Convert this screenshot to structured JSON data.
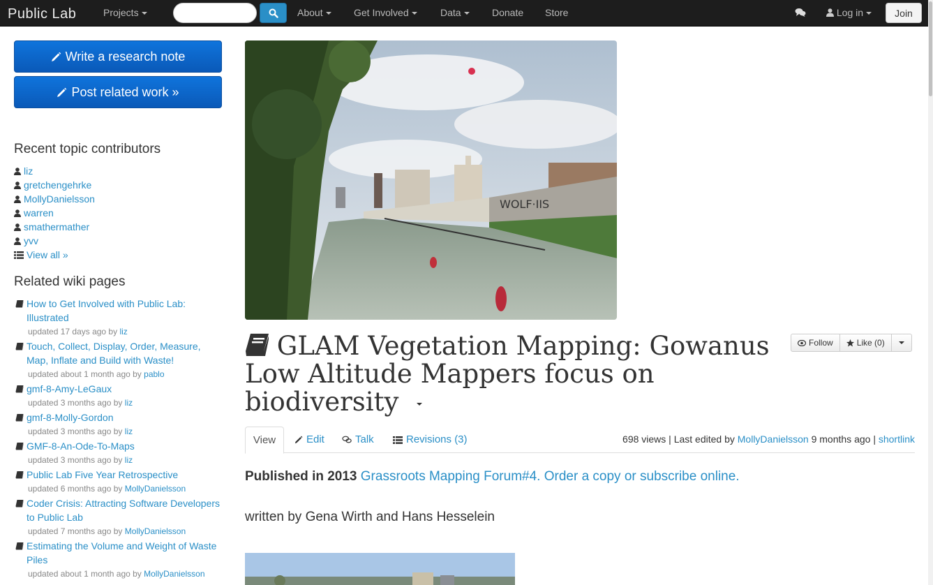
{
  "nav": {
    "brand": "Public Lab",
    "projects": "Projects",
    "search_placeholder": "",
    "about": "About",
    "get_involved": "Get Involved",
    "data": "Data",
    "donate": "Donate",
    "store": "Store",
    "login": "Log in",
    "join": "Join"
  },
  "sidebar": {
    "write_note": "Write a research note",
    "post_related": "Post related work »",
    "contributors_heading": "Recent topic contributors",
    "contributors": [
      "liz",
      "gretchengehrke",
      "MollyDanielsson",
      "warren",
      "smathermather",
      "yvv"
    ],
    "view_all": "View all »",
    "wiki_heading": "Related wiki pages",
    "wiki_pages": [
      {
        "title": "How to Get Involved with Public Lab: Illustrated",
        "updated": "updated 17 days ago by",
        "author": "liz"
      },
      {
        "title": "Touch, Collect, Display, Order, Measure, Map, Inflate and Build with Waste!",
        "updated": "updated about 1 month ago by",
        "author": "pablo"
      },
      {
        "title": "gmf-8-Amy-LeGaux",
        "updated": "updated 3 months ago by",
        "author": "liz"
      },
      {
        "title": "gmf-8-Molly-Gordon",
        "updated": "updated 3 months ago by",
        "author": "liz"
      },
      {
        "title": "GMF-8-An-Ode-To-Maps",
        "updated": "updated 3 months ago by",
        "author": "liz"
      },
      {
        "title": "Public Lab Five Year Retrospective",
        "updated": "updated 6 months ago by",
        "author": "MollyDanielsson"
      },
      {
        "title": "Coder Crisis: Attracting Software Developers to Public Lab",
        "updated": "updated 7 months ago by",
        "author": "MollyDanielsson"
      },
      {
        "title": "Estimating the Volume and Weight of Waste Piles",
        "updated": "updated about 1 month ago by",
        "author": "MollyDanielsson"
      }
    ]
  },
  "main": {
    "title": "GLAM Vegetation Mapping: Gowanus Low Altitude Mappers focus on biodiversity",
    "follow": "Follow",
    "like": "Like (0)",
    "tabs": {
      "view": "View",
      "edit": "Edit",
      "talk": "Talk",
      "revisions": "Revisions (3)"
    },
    "views": "698 views | Last edited by",
    "editor": "MollyDanielsson",
    "edited_ago": "9 months ago |",
    "shortlink": "shortlink",
    "published_bold": "Published in 2013",
    "published_link": "Grassroots Mapping Forum#4. Order a copy or subscribe online.",
    "written_by": "written by Gena Wirth and Hans Hesselein"
  },
  "colors": {
    "link": "#2a8fc7",
    "primary": "#0f74dc",
    "navbar": "#1d1d1d"
  }
}
